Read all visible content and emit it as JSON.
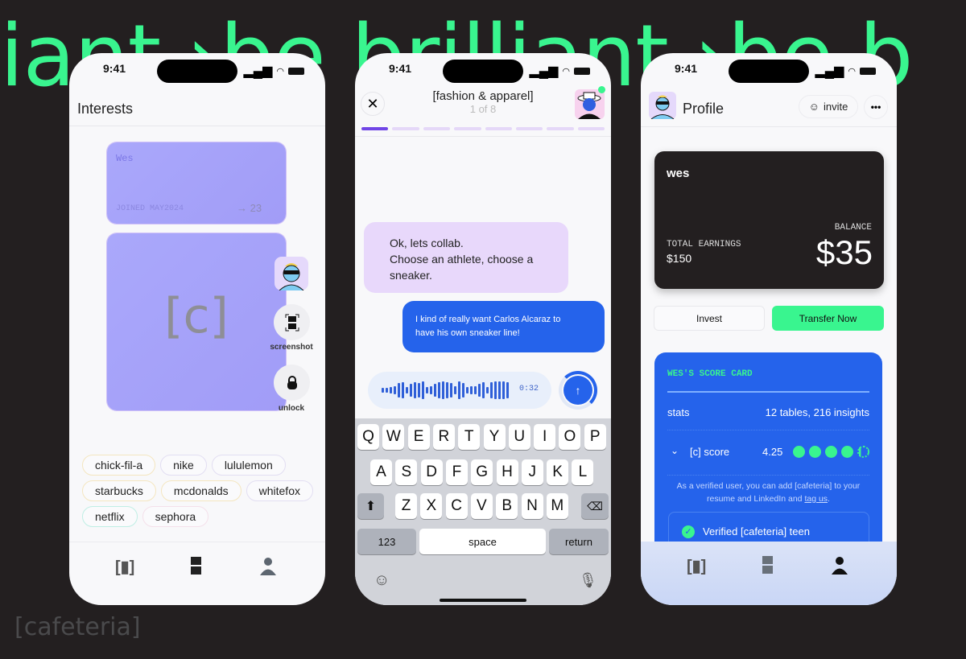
{
  "background": {
    "headline": "iant ›be brilliant ›be b",
    "brand": "[cafeteria]",
    "accent": "#39f58f"
  },
  "status": {
    "time": "9:41"
  },
  "interests": {
    "title": "Interests",
    "card": {
      "name": "Wes",
      "joined": "JOINED MAY2024",
      "count": "23"
    },
    "logo": "[c]",
    "actions": {
      "screenshot": "screenshot",
      "unlock": "unlock"
    },
    "tags": [
      "chick-fil-a",
      "nike",
      "lululemon",
      "starbucks",
      "mcdonalds",
      "whitefox",
      "netflix",
      "sephora"
    ]
  },
  "chat": {
    "title": "[fashion & apparel]",
    "subtitle": "1 of 8",
    "progress": {
      "current": 1,
      "total": 8
    },
    "bot_message": "Ok, lets collab.\nChoose an athlete, choose a sneaker.",
    "user_message": "I kind of really want Carlos Alcaraz to have his own sneaker line!",
    "voice_duration": "0:32",
    "keyboard": {
      "rows": [
        [
          "Q",
          "W",
          "E",
          "R",
          "T",
          "Y",
          "U",
          "I",
          "O",
          "P"
        ],
        [
          "A",
          "S",
          "D",
          "F",
          "G",
          "H",
          "J",
          "K",
          "L"
        ],
        [
          "Z",
          "X",
          "C",
          "V",
          "B",
          "N",
          "M"
        ]
      ],
      "numbers": "123",
      "space": "space",
      "return": "return"
    }
  },
  "profile": {
    "title": "Profile",
    "invite": "invite",
    "wallet": {
      "name": "wes",
      "earnings_label": "TOTAL EARNINGS",
      "earnings": "$150",
      "balance_label": "BALANCE",
      "balance": "$35"
    },
    "invest": "Invest",
    "transfer": "Transfer Now",
    "scorecard": {
      "title": "WES'S SCORE CARD",
      "stats_label": "stats",
      "stats_value": "12 tables, 216 insights",
      "score_label": "[c] score",
      "score_value": "4.25",
      "score_max": 5,
      "note": "As a verified user, you can add [cafeteria] to your resume and LinkedIn and ",
      "note_link": "tag us",
      "verified": "Verified [cafeteria] teen"
    }
  }
}
